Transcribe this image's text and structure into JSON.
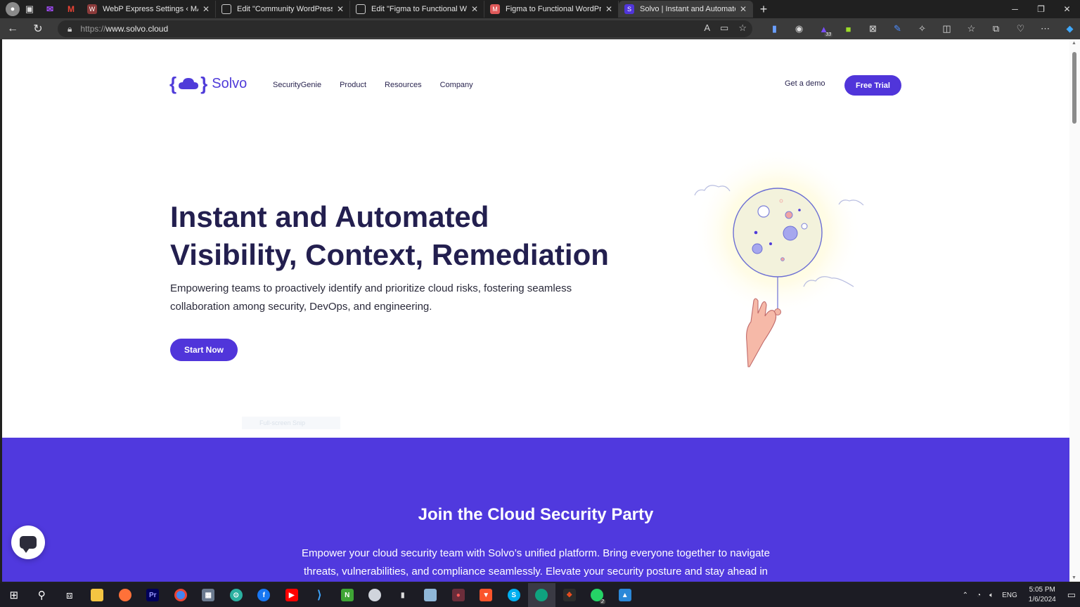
{
  "browser": {
    "tabs": [
      {
        "title": "WebP Express Settings ‹ MA UXU",
        "active": false
      },
      {
        "title": "Edit \"Community WordPress The",
        "active": false
      },
      {
        "title": "Edit \"Figma to Functional WordP",
        "active": false
      },
      {
        "title": "Figma to Functional WordPress V",
        "active": false
      },
      {
        "title": "Solvo | Instant and Automated V",
        "active": true
      }
    ],
    "url_scheme": "https://",
    "url_host": "www.solvo.cloud",
    "extension_badge": "33"
  },
  "site": {
    "brand": "Solvo",
    "nav": [
      "SecurityGenie",
      "Product",
      "Resources",
      "Company"
    ],
    "get_demo": "Get a demo",
    "free_trial": "Free Trial",
    "hero_title_line1": "Instant and Automated",
    "hero_title_line2": "Visibility, Context, Remediation",
    "hero_subtitle": "Empowering teams to proactively identify and prioritize cloud risks, fostering seamless collaboration among security, DevOps, and engineering.",
    "cta": "Start Now",
    "ghost_text": "Full-screen Snip",
    "band_title": "Join the Cloud Security Party",
    "band_text": "Empower your cloud security team with Solvo’s unified platform. Bring everyone together to navigate threats, vulnerabilities, and compliance seamlessly. Elevate your security posture and stay ahead in"
  },
  "colors": {
    "brand_purple": "#5035da",
    "heading": "#231f4f",
    "band": "#5039de"
  },
  "taskbar": {
    "language": "ENG",
    "time": "5:05 PM",
    "date": "1/6/2024",
    "whatsapp_badge": "2"
  }
}
